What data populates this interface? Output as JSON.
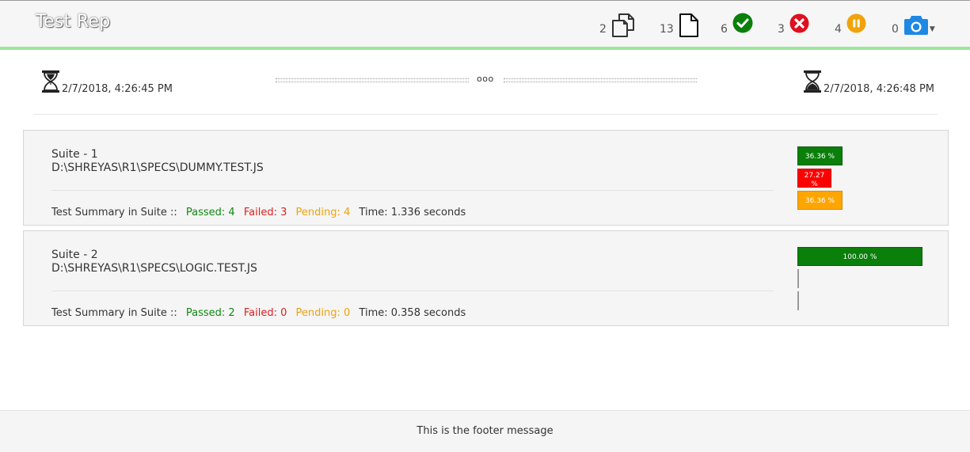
{
  "header": {
    "title": "Test Rep",
    "stats": {
      "suites": {
        "count": "2",
        "icon": "copy-icon"
      },
      "tests": {
        "count": "13",
        "icon": "file-icon"
      },
      "passed": {
        "count": "6",
        "icon": "check-circle-icon",
        "color": "#0a7f0a"
      },
      "failed": {
        "count": "3",
        "icon": "x-circle-icon",
        "color": "#e0101e"
      },
      "pending": {
        "count": "4",
        "icon": "pause-circle-icon",
        "color": "#f0a30a"
      },
      "screenshots": {
        "count": "0",
        "icon": "camera-icon",
        "color": "#1e88e5"
      }
    },
    "accent_line_color": "#9fe59f"
  },
  "timing": {
    "start": "2/7/2018, 4:26:45 PM",
    "end": "2/7/2018, 4:26:48 PM",
    "duration": "ooo"
  },
  "suites": [
    {
      "name": "Suite - 1",
      "path": "D:\\SHREYAS\\R1\\SPECS\\DUMMY.TEST.JS",
      "summary_label": "Test Summary in Suite ::",
      "passed": "Passed: 4",
      "failed": "Failed: 3",
      "pending": "Pending: 4",
      "time": "Time: 1.336 seconds",
      "bars": {
        "pass_label": "36.36 %",
        "pass_fraction": 0.3636,
        "fail_label_line1": "27.27",
        "fail_label_line2": "%",
        "fail_fraction": 0.2727,
        "pending_label": "36.36 %",
        "pending_fraction": 0.3636
      }
    },
    {
      "name": "Suite - 2",
      "path": "D:\\SHREYAS\\R1\\SPECS\\LOGIC.TEST.JS",
      "summary_label": "Test Summary in Suite ::",
      "passed": "Passed: 2",
      "failed": "Failed: 0",
      "pending": "Pending: 0",
      "time": "Time: 0.358 seconds",
      "bars": {
        "pass_label": "100.00 %",
        "pass_fraction": 1.0,
        "fail_fraction": 0.0,
        "pending_fraction": 0.0
      }
    }
  ],
  "footer": {
    "message": "This is the footer message"
  }
}
